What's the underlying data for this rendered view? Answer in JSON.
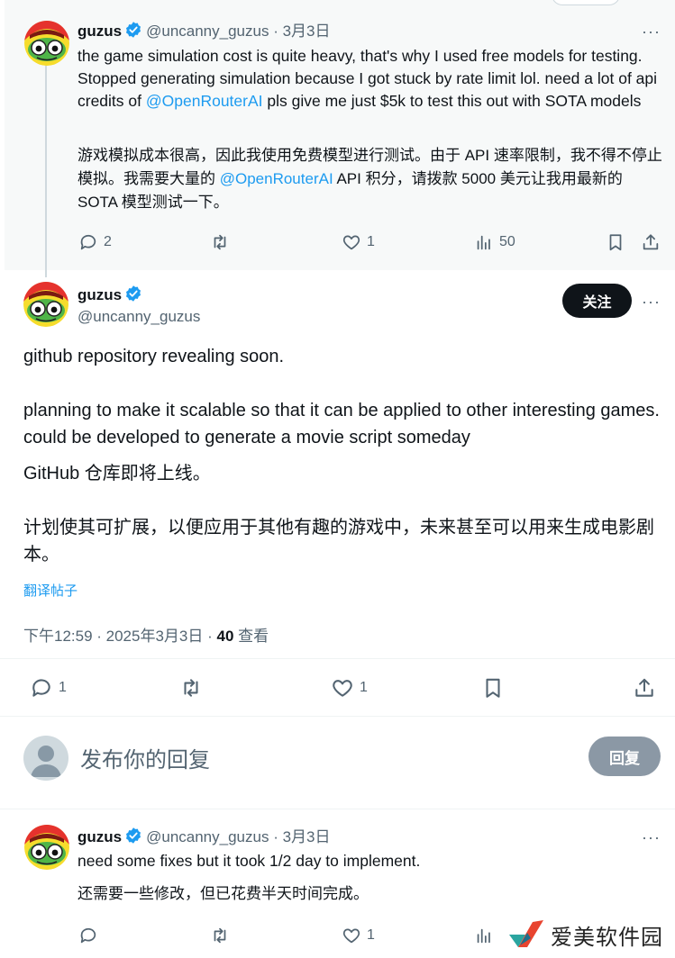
{
  "tweet1": {
    "name": "guzus",
    "handle": "@uncanny_guzus",
    "date": "3月3日",
    "text_en_1": "the game simulation cost is quite heavy, that's why I used free models for testing. Stopped generating simulation because I got stuck by rate limit lol. need a lot of api credits  of ",
    "mention_1": "@OpenRouterAI",
    "text_en_2": " pls give me just $5k to test this out with SOTA models",
    "text_zh_1": "游戏模拟成本很高，因此我使用免费模型进行测试。由于 API 速率限制，我不得不停止模拟。我需要大量的 ",
    "mention_2": "@OpenRouterAI",
    "text_zh_2": " API 积分，请拨款 5000 美元让我用最新的 SOTA 模型测试一下。",
    "replies": "2",
    "likes": "1",
    "views": "50"
  },
  "main": {
    "name": "guzus",
    "handle": "@uncanny_guzus",
    "follow_label": "关注",
    "text_en_1": "github repository revealing soon.",
    "text_en_2": "planning to make it scalable so that it can be applied to other interesting games. could be developed to generate a movie script someday",
    "text_zh_1": "GitHub 仓库即将上线。",
    "text_zh_2": "计划使其可扩展，以便应用于其他有趣的游戏中，未来甚至可以用来生成电影剧本。",
    "translate_label": "翻译帖子",
    "time": "下午12:59 · 2025年3月3日 · ",
    "views_count": "40",
    "views_label": " 查看",
    "replies": "1",
    "likes": "1"
  },
  "composer": {
    "placeholder": "发布你的回复",
    "reply_label": "回复"
  },
  "tweet3": {
    "name": "guzus",
    "handle": "@uncanny_guzus",
    "date": "3月3日",
    "text_en": "need some fixes but it took 1/2 day to implement.",
    "text_zh": "还需要一些修改，但已花费半天时间完成。",
    "likes": "1"
  },
  "watermark": {
    "text": "爱美软件园"
  },
  "icons": {
    "reply": "reply-icon",
    "retweet": "retweet-icon",
    "like": "heart-icon",
    "views": "views-icon",
    "bookmark": "bookmark-icon",
    "share": "share-icon",
    "verified": "verified-badge-icon",
    "more": "more-icon"
  },
  "colors": {
    "accent": "#1d9bf0",
    "text": "#0f1419",
    "muted": "#536471",
    "button_dark": "#0f1419",
    "reply_disabled": "#8b98a5"
  }
}
